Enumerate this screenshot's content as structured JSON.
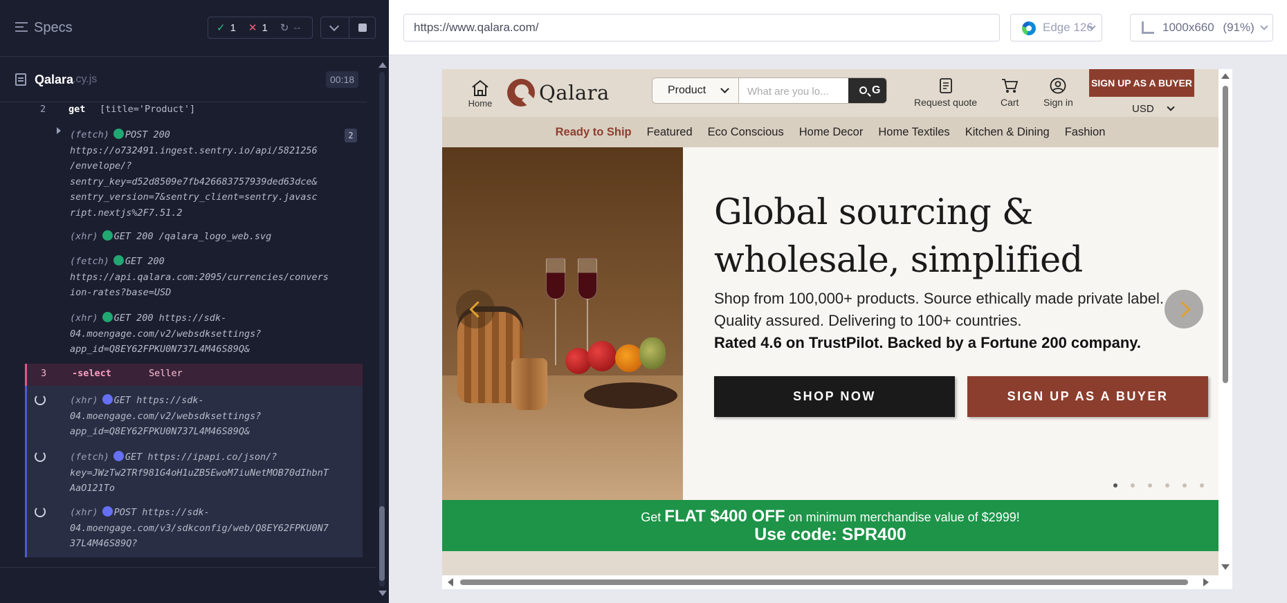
{
  "runner": {
    "specs_title": "Specs",
    "stats": {
      "passed": "1",
      "failed": "1",
      "pending": "--"
    },
    "file": {
      "name": "Qalara",
      "ext": ".cy.js",
      "duration": "00:18"
    }
  },
  "log": {
    "cmd2": {
      "num": "2",
      "name": "get",
      "arg": "[title='Product']"
    },
    "entries": [
      {
        "type": "(fetch)",
        "status": "POST 200",
        "lines": [
          "https://o732491.ingest.sentry.io/api/5821256",
          "/envelope/?",
          "sentry_key=d52d8509e7fb426683757939ded63dce&",
          "sentry_version=7&sentry_client=sentry.javasc",
          "ript.nextjs%2F7.51.2"
        ],
        "count": "2"
      },
      {
        "type": "(xhr)",
        "status": "GET 200 /qalara_logo_web.svg",
        "lines": []
      },
      {
        "type": "(fetch)",
        "status": "GET 200",
        "lines": [
          "https://api.qalara.com:2095/currencies/convers",
          "ion-rates?base=USD"
        ]
      },
      {
        "type": "(xhr)",
        "status": "GET 200 https://sdk-",
        "lines": [
          "04.moengage.com/v2/websdksettings?",
          "app_id=Q8EY62FPKU0N737L4M46S89Q&"
        ]
      }
    ],
    "cmd3": {
      "num": "3",
      "name": "-select",
      "arg": "Seller"
    },
    "pending": [
      {
        "type": "(xhr)",
        "status": "GET https://sdk-",
        "lines": [
          "04.moengage.com/v2/websdksettings?",
          "app_id=Q8EY62FPKU0N737L4M46S89Q&"
        ]
      },
      {
        "type": "(fetch)",
        "status": "GET https://ipapi.co/json/?",
        "lines": [
          "key=JWzTw2TRf981G4oH1uZB5EwoM7iuNetMOB70dIhbnT",
          "AaO121To"
        ]
      },
      {
        "type": "(xhr)",
        "status": "POST https://sdk-",
        "lines": [
          "04.moengage.com/v3/sdkconfig/web/Q8EY62FPKU0N7",
          "37L4M46S89Q?"
        ]
      }
    ]
  },
  "browser": {
    "url": "https://www.qalara.com/",
    "engine": "Edge 126",
    "viewport": "1000x660",
    "zoom": "(91%)"
  },
  "site": {
    "home_label": "Home",
    "logo_text": "Qalara",
    "search_category": "Product",
    "search_placeholder": "What are you lo...",
    "search_btn": "G",
    "request_quote": "Request quote",
    "cart": "Cart",
    "sign_in": "Sign in",
    "signup_header": "SIGN UP AS A BUYER",
    "currency": "USD",
    "nav": [
      "Ready to Ship",
      "Featured",
      "Eco Conscious",
      "Home Decor",
      "Home Textiles",
      "Kitchen & Dining",
      "Fashion"
    ],
    "hero": {
      "title_1": "Global sourcing &",
      "title_2": "wholesale, simplified",
      "line_1": "Shop from 100,000+ products. Source ethically made private label.",
      "line_2": "Quality assured. Delivering to 100+ countries.",
      "line_3": "Rated 4.6 on TrustPilot. Backed by a Fortune 200 company.",
      "shop_now": "SHOP NOW",
      "signup": "SIGN UP AS A BUYER"
    },
    "promo": {
      "prefix": "Get",
      "highlight": "FLAT $400 OFF",
      "suffix": "on minimum merchandise value of $2999!",
      "code": "Use code: SPR400"
    },
    "colors": {
      "brand": "#8c3e2e",
      "promo": "#1d9448",
      "nav_bg": "#d9cfc1"
    }
  }
}
